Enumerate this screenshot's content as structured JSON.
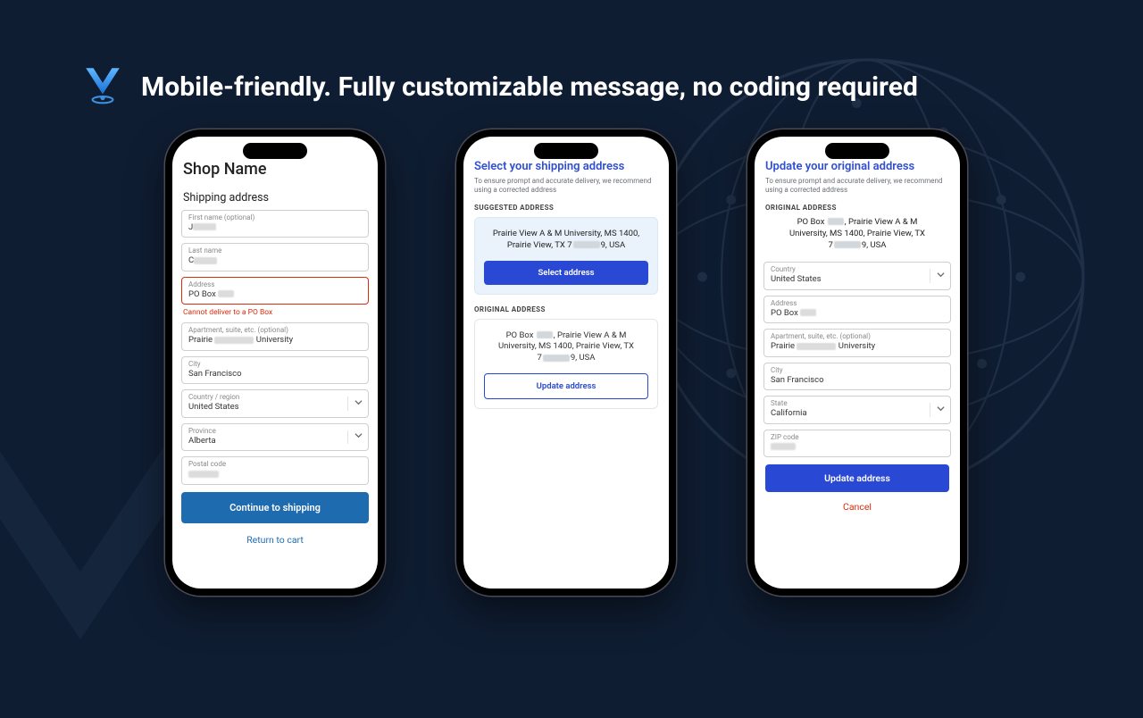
{
  "headline": "Mobile-friendly. Fully customizable message, no coding required",
  "phone1": {
    "shop": "Shop Name",
    "section": "Shipping address",
    "first_name_lbl": "First name (optional)",
    "first_name_val": "J",
    "last_name_lbl": "Last name",
    "last_name_val": "C",
    "address_lbl": "Address",
    "address_val": "PO Box",
    "address_error": "Cannot deliver to a PO Box",
    "apt_lbl": "Apartment, suite, etc. (optional)",
    "apt_val_prefix": "Prairie",
    "apt_val_suffix": "University",
    "city_lbl": "City",
    "city_val": "San Francisco",
    "country_lbl": "Country / region",
    "country_val": "United States",
    "province_lbl": "Province",
    "province_val": "Alberta",
    "postal_lbl": "Postal code",
    "continue": "Continue to shipping",
    "return": "Return to cart"
  },
  "phone2": {
    "title": "Select your shipping address",
    "subtitle": "To ensure prompt and accurate delivery, we recommend using a corrected address",
    "suggested_head": "SUGGESTED ADDRESS",
    "suggested_line1": "Prairie View A & M University, MS 1400,",
    "suggested_line2_a": "Prairie View, TX 7",
    "suggested_line2_b": "9, USA",
    "select_btn": "Select address",
    "original_head": "ORIGINAL ADDRESS",
    "original_line1_a": "PO Box",
    "original_line1_b": ", Prairie View A & M",
    "original_line2": "University, MS 1400, Prairie View, TX",
    "original_line3_a": "7",
    "original_line3_b": "9, USA",
    "update_btn": "Update address"
  },
  "phone3": {
    "title": "Update your original address",
    "subtitle": "To ensure prompt and accurate delivery, we recommend using a corrected address",
    "original_head": "ORIGINAL ADDRESS",
    "orig_line1_a": "PO Box",
    "orig_line1_b": ", Prairie View A & M",
    "orig_line2": "University, MS 1400, Prairie View, TX",
    "orig_line3_a": "7",
    "orig_line3_b": "9, USA",
    "country_lbl": "Country",
    "country_val": "United States",
    "address_lbl": "Address",
    "address_val": "PO Box",
    "apt_lbl": "Apartment, suite, etc. (optional)",
    "apt_prefix": "Prairie",
    "apt_suffix": "University",
    "city_lbl": "City",
    "city_val": "San Francisco",
    "state_lbl": "State",
    "state_val": "California",
    "zip_lbl": "ZIP code",
    "update_btn": "Update address",
    "cancel": "Cancel"
  }
}
